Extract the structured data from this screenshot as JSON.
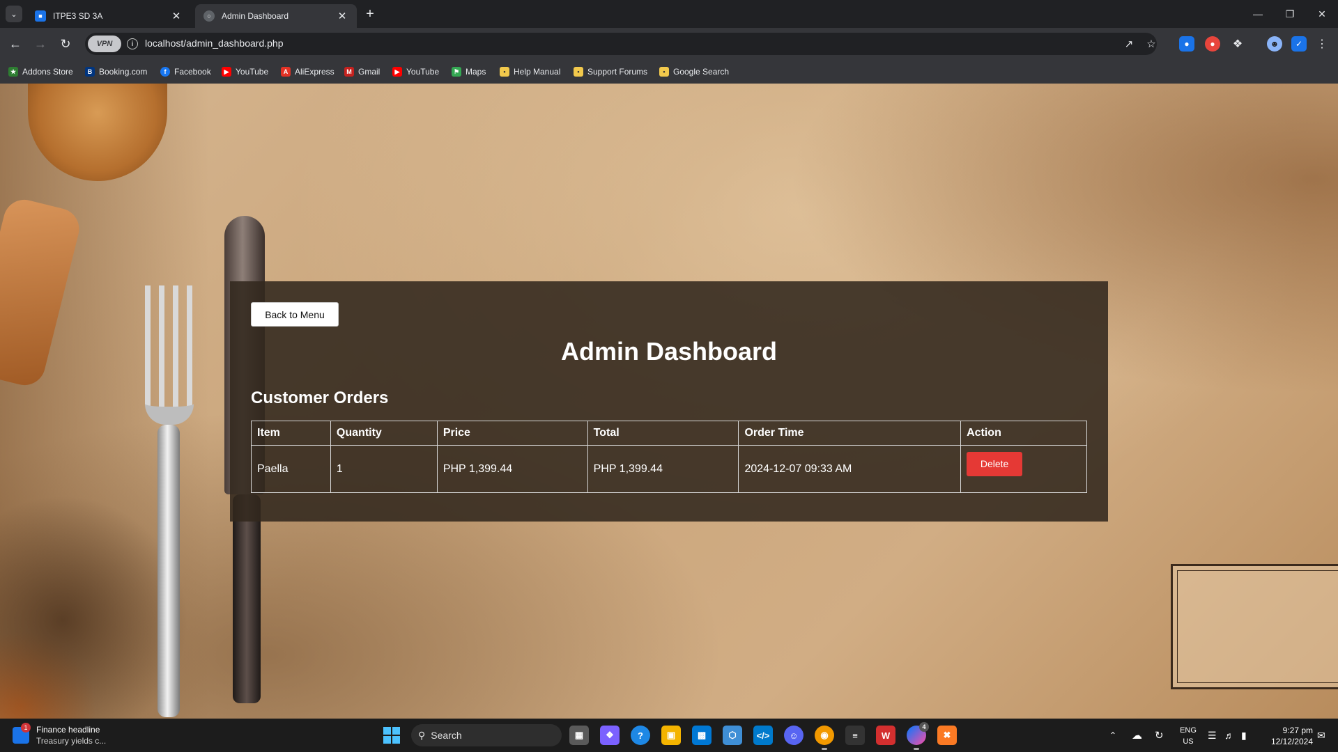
{
  "browser": {
    "tabs": [
      {
        "title": "ITPE3 SD 3A",
        "active": false
      },
      {
        "title": "Admin Dashboard",
        "active": true
      }
    ],
    "new_tab_symbol": "+",
    "vpn_label": "VPN",
    "url": "localhost/admin_dashboard.php",
    "bookmarks": [
      {
        "label": "Addons Store",
        "icon": "addons-icon",
        "color": "#2e7d32"
      },
      {
        "label": "Booking.com",
        "icon": "booking-icon",
        "color": "#003580"
      },
      {
        "label": "Facebook",
        "icon": "facebook-icon",
        "color": "#1877f2"
      },
      {
        "label": "YouTube",
        "icon": "youtube-icon",
        "color": "#ff0000"
      },
      {
        "label": "AliExpress",
        "icon": "aliexpress-icon",
        "color": "#e43225"
      },
      {
        "label": "Gmail",
        "icon": "gmail-icon",
        "color": "#c5221f"
      },
      {
        "label": "YouTube",
        "icon": "youtube-icon",
        "color": "#ff0000"
      },
      {
        "label": "Maps",
        "icon": "maps-icon",
        "color": "#34a853"
      },
      {
        "label": "Help Manual",
        "icon": "help-icon",
        "color": "#f2c94c"
      },
      {
        "label": "Support Forums",
        "icon": "forums-icon",
        "color": "#f2c94c"
      },
      {
        "label": "Google Search",
        "icon": "google-search-icon",
        "color": "#f2c94c"
      }
    ]
  },
  "page": {
    "back_button": "Back to Menu",
    "title": "Admin Dashboard",
    "section_title": "Customer Orders",
    "table": {
      "headers": [
        "Item",
        "Quantity",
        "Price",
        "Total",
        "Order Time",
        "Action"
      ],
      "rows": [
        {
          "item": "Paella",
          "quantity": "1",
          "price": "PHP 1,399.44",
          "total": "PHP 1,399.44",
          "order_time": "2024-12-07 09:33 AM",
          "action": "Delete"
        }
      ]
    },
    "colors": {
      "panel": "#32281e",
      "delete_button": "#e53935"
    }
  },
  "taskbar": {
    "news_title": "Finance headline",
    "news_subtitle": "Treasury yields c...",
    "news_badge": "1",
    "search_placeholder": "Search",
    "messenger_badge": "4",
    "language": "ENG",
    "region": "US",
    "time": "9:27 pm",
    "date": "12/12/2024"
  }
}
